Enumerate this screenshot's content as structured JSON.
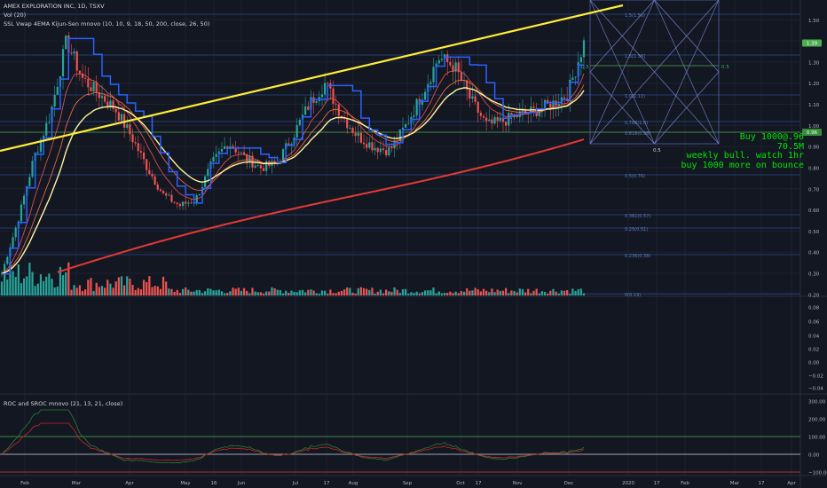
{
  "header": {
    "symbol": "AMEX EXPLORATION INC, 1D, TSXV",
    "vol": "Vol (20)",
    "ssl": "SSL Vwap 4EMA Kijun-Sen mnovo (10, 10, 9, 18, 50, 200, close, 26, 50)",
    "roc": "ROC and SROC mnovo (21, 13, 21, close)"
  },
  "note": {
    "line1": "Buy 1000@.96",
    "line2": "70.5M",
    "line3": "weekly bull. watch 1hr",
    "line4": "buy 1000 more on bounce"
  },
  "colors": {
    "background": "#131722",
    "grid": "#1e2230",
    "up": "#26a69a",
    "down": "#ef5350",
    "trendline": "#ffeb3b",
    "ma200": "#e53935",
    "vwap": "#fff59d",
    "ssl": "#2962ff",
    "fib": "#2a4a8a",
    "price_tag": "#4caf50"
  },
  "chart_data": [
    {
      "type": "line",
      "title": "AMEX EXPLORATION INC, 1D, TSXV",
      "price_axis": {
        "ticks": [
          "1.50",
          "1.40",
          "1.30",
          "1.20",
          "1.10",
          "1.00",
          "0.90",
          "0.80",
          "0.70",
          "0.60",
          "0.50",
          "0.40",
          "0.30",
          "0.20"
        ],
        "range": [
          0.195,
          1.56
        ]
      },
      "current_price_tag": "1.39",
      "level_tag": "0.96",
      "x_axis": {
        "ticks": [
          "Feb",
          "Mar",
          "Apr",
          "May",
          "16",
          "Jun",
          "Jul",
          "17",
          "Aug",
          "Sep",
          "Oct",
          "17",
          "Nov",
          "Dec",
          "2020",
          "17",
          "Feb",
          "Mar",
          "17",
          "Apr"
        ]
      },
      "series": [
        {
          "name": "",
          "values": [
            0.3,
            0.55,
            0.85,
            1.05,
            1.4,
            1.22,
            1.15,
            1.08,
            0.95,
            0.8,
            0.67,
            0.62,
            0.65,
            0.82,
            0.92,
            0.85,
            0.8,
            0.82,
            0.95,
            1.1,
            1.2,
            1.05,
            0.95,
            0.9,
            0.88,
            1.0,
            1.15,
            1.32,
            1.28,
            1.12,
            1.0,
            1.02,
            1.05,
            1.07,
            1.1,
            1.15,
            1.39
          ]
        }
      ],
      "annotations": {
        "fib_levels": [
          "1.5(1.56)",
          "1.5[1.36]",
          "1.0(1.11)",
          "0.786(1.0)",
          "0.618(0.96)",
          "0.5(0.76)",
          "0.382(0.57)",
          "0.25(0.51)",
          "0.236(0.38)",
          "0(0.19)"
        ],
        "gann_labels": [
          "0.5",
          "0.5",
          "0.5"
        ]
      }
    },
    {
      "type": "bar",
      "title": "",
      "price_axis": {
        "ticks": [
          "0.08",
          "0.06",
          "0.04",
          "0.02",
          "0.00",
          "−0.02",
          "−0.04"
        ]
      }
    },
    {
      "type": "line",
      "title": "ROC and SROC mnovo (21, 13, 21, close)",
      "y_axis": {
        "ticks": [
          "300.00",
          "200.00",
          "100.00",
          "0.00",
          "−100.00"
        ],
        "range": [
          -120,
          320
        ]
      },
      "reference_lines": [
        100,
        0,
        -100
      ]
    }
  ]
}
